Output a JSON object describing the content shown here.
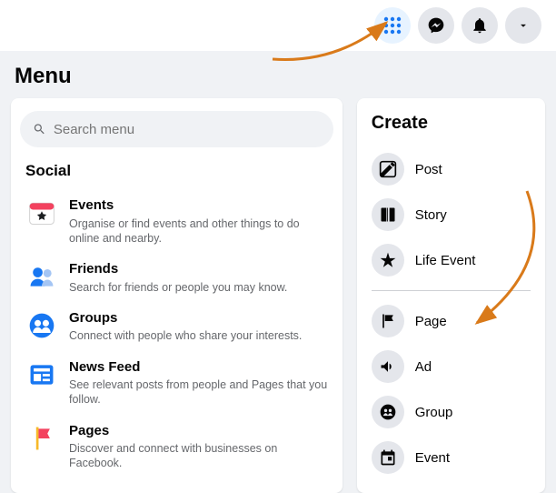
{
  "header": {
    "icons": [
      "menu-grid",
      "messenger",
      "notifications",
      "account"
    ]
  },
  "page_title": "Menu",
  "search": {
    "placeholder": "Search menu"
  },
  "social": {
    "heading": "Social",
    "items": [
      {
        "icon": "events",
        "title": "Events",
        "desc": "Organise or find events and other things to do online and nearby."
      },
      {
        "icon": "friends",
        "title": "Friends",
        "desc": "Search for friends or people you may know."
      },
      {
        "icon": "groups",
        "title": "Groups",
        "desc": "Connect with people who share your interests."
      },
      {
        "icon": "news-feed",
        "title": "News Feed",
        "desc": "See relevant posts from people and Pages that you follow."
      },
      {
        "icon": "pages",
        "title": "Pages",
        "desc": "Discover and connect with businesses on Facebook."
      }
    ]
  },
  "create": {
    "heading": "Create",
    "items_top": [
      {
        "icon": "post",
        "label": "Post"
      },
      {
        "icon": "story",
        "label": "Story"
      },
      {
        "icon": "life-event",
        "label": "Life Event"
      }
    ],
    "items_bottom": [
      {
        "icon": "page",
        "label": "Page"
      },
      {
        "icon": "ad",
        "label": "Ad"
      },
      {
        "icon": "group",
        "label": "Group"
      },
      {
        "icon": "event",
        "label": "Event"
      }
    ]
  }
}
